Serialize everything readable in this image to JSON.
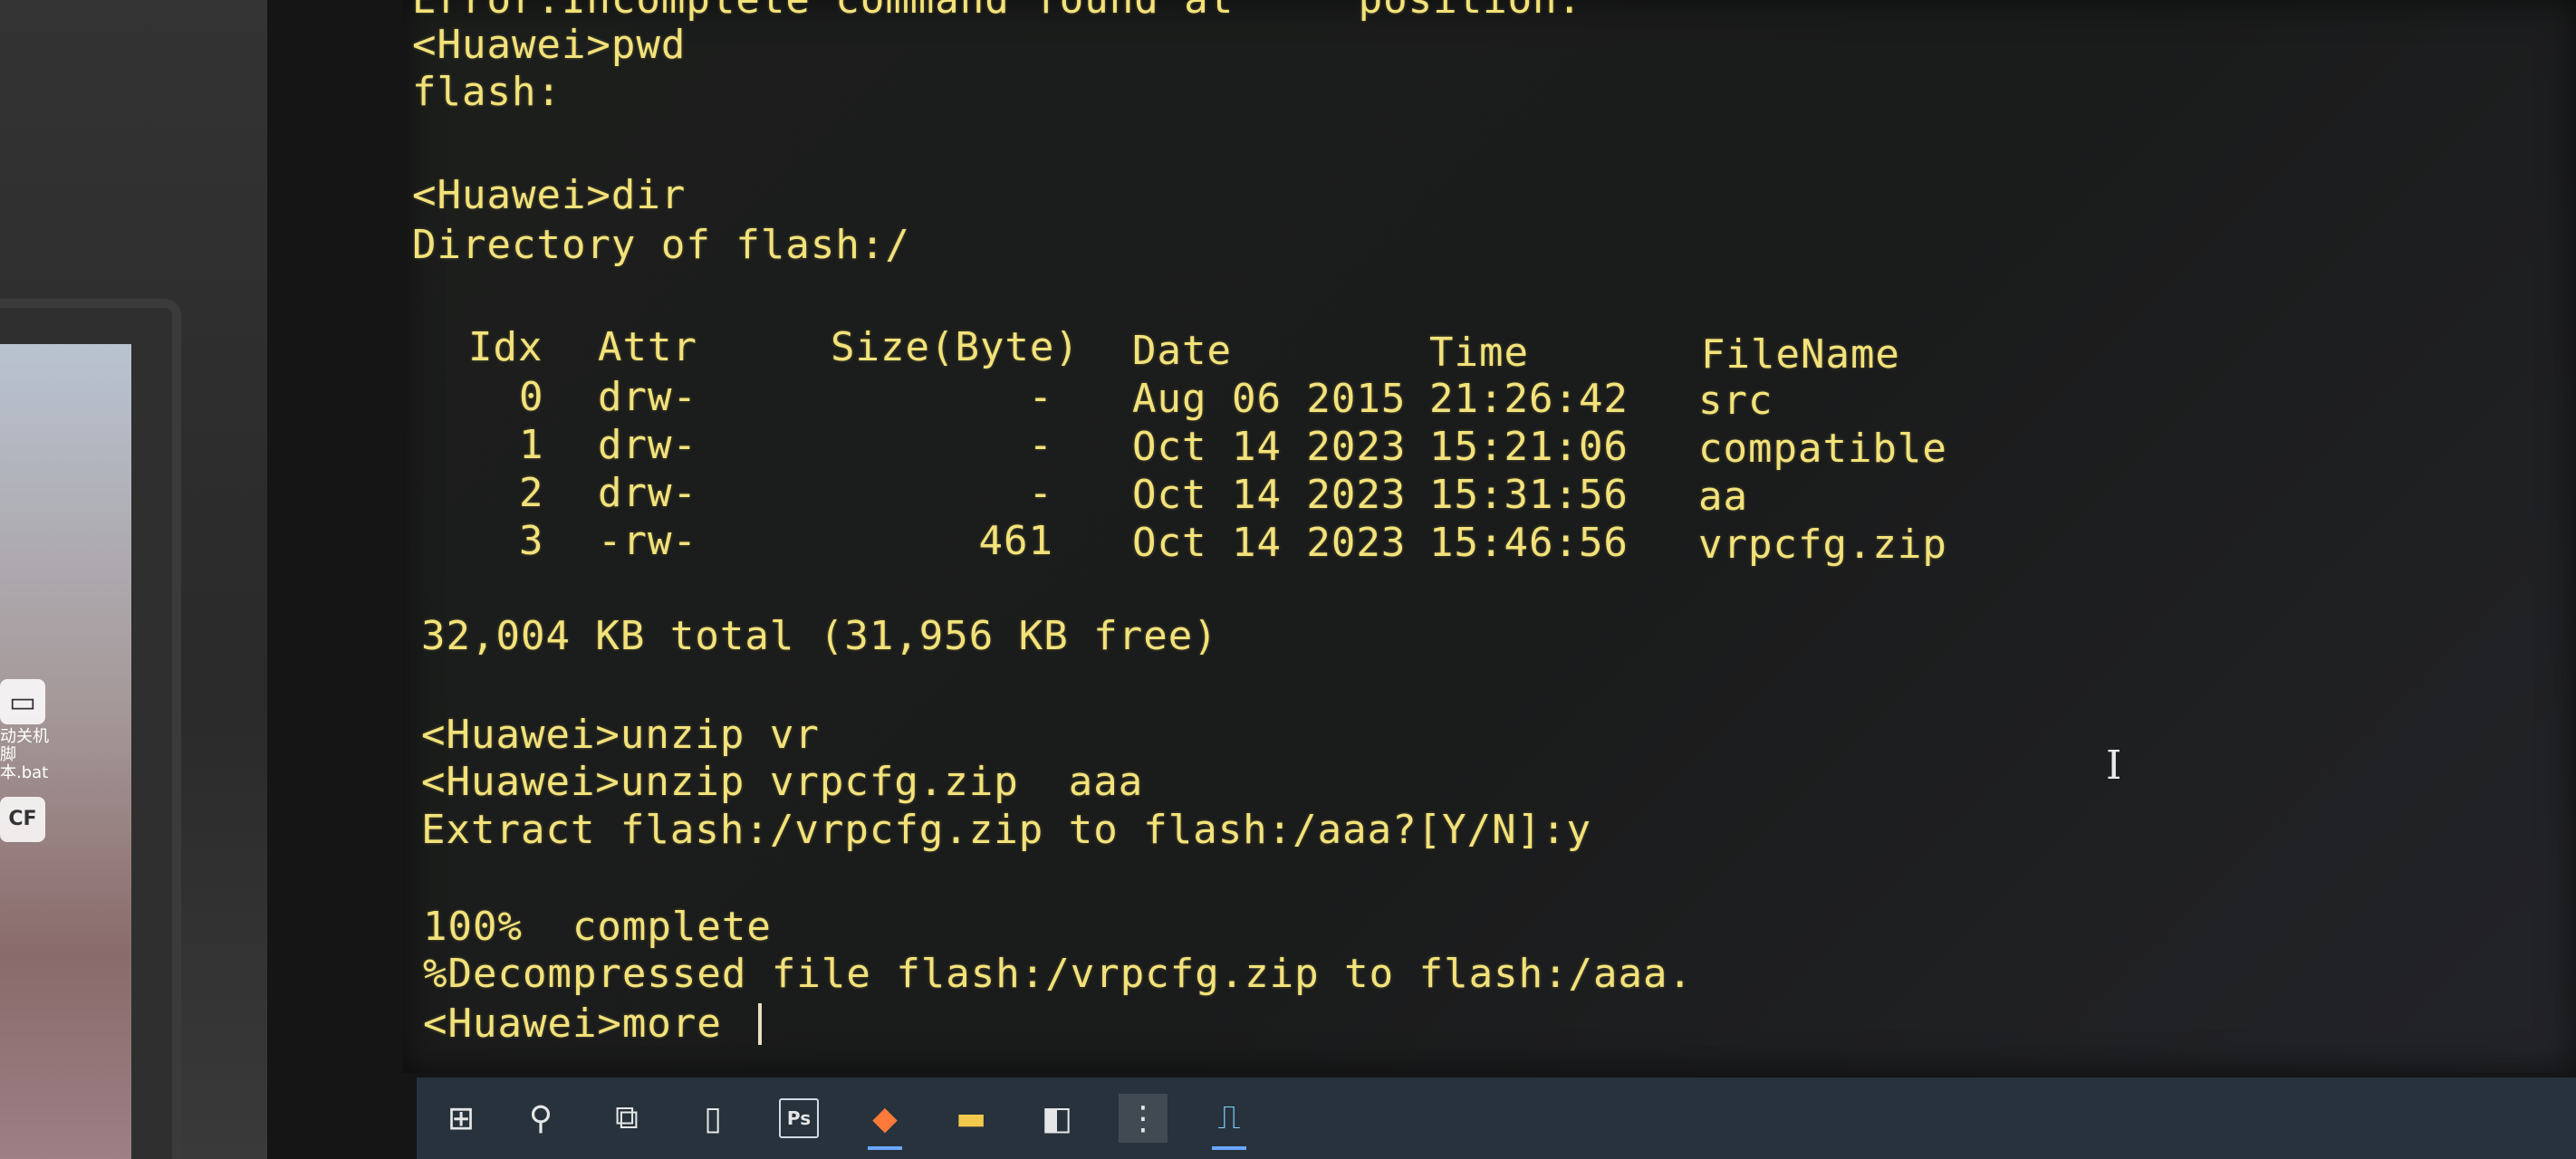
{
  "terminal": {
    "text_color": "#f3e27a",
    "lines": {
      "error_partial": "Error:Incomplete command found at '^' position.",
      "pwd_cmd": "<Huawei>pwd",
      "pwd_out": "flash:",
      "dir_cmd": "<Huawei>dir",
      "dir_header": "Directory of flash:/",
      "total": "32,004 KB total (31,956 KB free)",
      "unzip1": "<Huawei>unzip vr",
      "unzip2": "<Huawei>unzip vrpcfg.zip  aaa",
      "extract": "Extract flash:/vrpcfg.zip to flash:/aaa?[Y/N]:y",
      "progress": "100%  complete",
      "decompressed": "%Decompressed file flash:/vrpcfg.zip to flash:/aaa.",
      "current_prompt": "<Huawei>more "
    },
    "table": {
      "headers": [
        "Idx",
        "Attr",
        "Size(Byte)",
        "Date",
        "Time",
        "FileName"
      ],
      "rows": [
        {
          "idx": "0",
          "attr": "drw-",
          "size": "-",
          "date": "Aug 06 2015",
          "time": "21:26:42",
          "name": "src"
        },
        {
          "idx": "1",
          "attr": "drw-",
          "size": "-",
          "date": "Oct 14 2023",
          "time": "15:21:06",
          "name": "compatible"
        },
        {
          "idx": "2",
          "attr": "drw-",
          "size": "-",
          "date": "Oct 14 2023",
          "time": "15:31:56",
          "name": "aa"
        },
        {
          "idx": "3",
          "attr": "-rw-",
          "size": "461",
          "date": "Oct 14 2023",
          "time": "15:46:56",
          "name": "vrpcfg.zip"
        }
      ]
    }
  },
  "desktop_icons": [
    {
      "label": "动关机脚本.bat",
      "icon": "batch-file-icon"
    },
    {
      "label": "CF",
      "icon": "crossfire-icon"
    }
  ],
  "taskbar": {
    "items": [
      {
        "name": "start-button",
        "icon": "windows-logo-icon"
      },
      {
        "name": "search-button",
        "icon": "search-icon"
      },
      {
        "name": "task-view-button",
        "icon": "task-view-icon"
      },
      {
        "name": "notepad-button",
        "icon": "file-icon"
      },
      {
        "name": "photoshop-button",
        "icon": "photoshop-icon",
        "label": "Ps"
      },
      {
        "name": "app-orange-button",
        "icon": "app-icon"
      },
      {
        "name": "file-explorer-button",
        "icon": "folder-icon"
      },
      {
        "name": "app-window-button",
        "icon": "window-icon"
      },
      {
        "name": "network-tool-button",
        "icon": "network-icon"
      },
      {
        "name": "terminal-button",
        "icon": "terminal-waveform-icon"
      }
    ]
  }
}
